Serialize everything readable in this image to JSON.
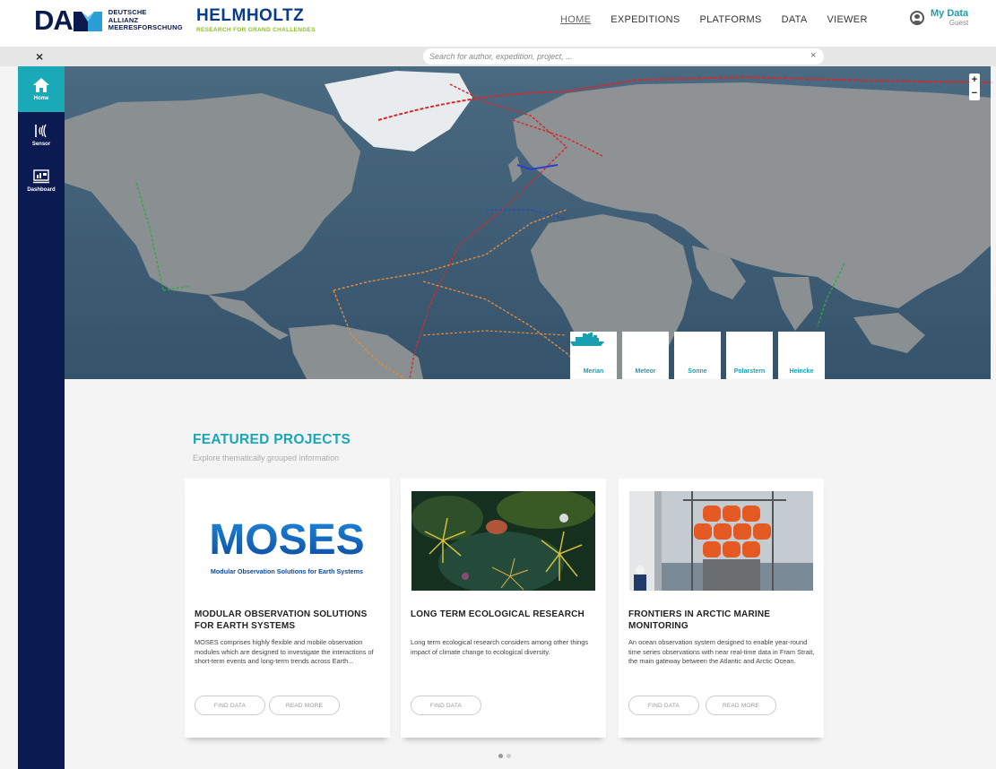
{
  "header": {
    "dam_logo_text": "DAM",
    "dam_logo_sub": [
      "DEUTSCHE",
      "ALLIANZ",
      "MEERESFORSCHUNG"
    ],
    "helmholtz_title": "HELMHOLTZ",
    "helmholtz_sub": "RESEARCH FOR GRAND CHALLENGES",
    "nav": [
      "HOME",
      "EXPEDITIONS",
      "PLATFORMS",
      "DATA",
      "VIEWER"
    ],
    "nav_active": "HOME",
    "user_name": "My Data",
    "user_role": "Guest"
  },
  "search": {
    "close_icon": "×",
    "placeholder": "Search for author, expedition, project, ...",
    "clear_icon": "×"
  },
  "sidebar": {
    "items": [
      {
        "label": "Home",
        "icon": "home-icon",
        "active": true
      },
      {
        "label": "Sensor",
        "icon": "sensor-icon",
        "active": false
      },
      {
        "label": "Dashboard",
        "icon": "dashboard-icon",
        "active": false
      }
    ]
  },
  "map": {
    "zoom_in": "+",
    "zoom_out": "−",
    "vessels": [
      "Merian",
      "Meteor",
      "Sonne",
      "Polarstern",
      "Heincke"
    ]
  },
  "featured": {
    "title": "FEATURED PROJECTS",
    "subtitle": "Explore thematically grouped information",
    "cards": [
      {
        "logo_text": "MOSES",
        "logo_caption": "Modular Observation Solutions for Earth Systems",
        "title": "MODULAR OBSERVATION SOLUTIONS FOR EARTH SYSTEMS",
        "description": "MOSES comprises highly flexible and mobile observation modules which are designed to investigate the interactions of short-term events and long-term trends across Earth...",
        "buttons": [
          "FIND DATA",
          "READ MORE"
        ]
      },
      {
        "title": "LONG TERM ECOLOGICAL RESEARCH",
        "description": "Long term ecological research considers among other things impact of climate change to ecological diversity.",
        "buttons": [
          "FIND DATA"
        ]
      },
      {
        "title": "FRONTIERS IN ARCTIC MARINE MONITORING",
        "description": "An ocean observation system designed to enable year-round time series observations with near real-time data in Fram Strait, the main gateway between the Atlantic and Arctic Ocean.",
        "buttons": [
          "FIND DATA",
          "READ MORE"
        ]
      }
    ],
    "carousel_pages": 2,
    "carousel_active": 1
  },
  "colors": {
    "accent": "#1aa9b6",
    "sidebar": "#0c1a52",
    "brand_blue": "#0a3a8a",
    "brand_green": "#8cbf26"
  }
}
